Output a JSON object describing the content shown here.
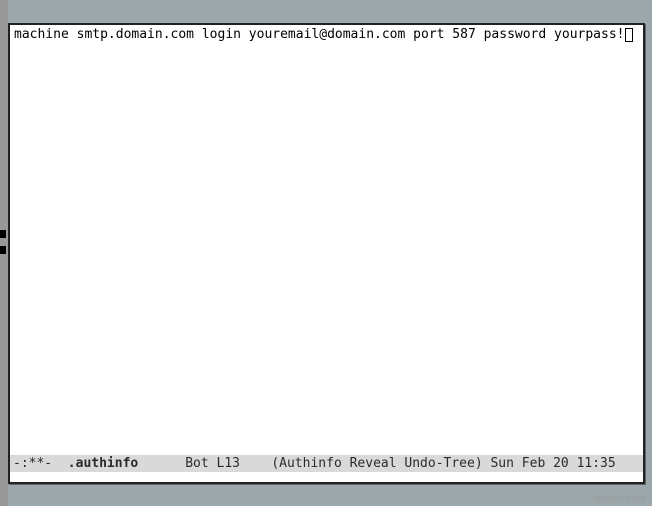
{
  "buffer": {
    "line1": "machine smtp.domain.com login youremail@domain.com port 587 password yourpass!"
  },
  "modeline": {
    "status": "-:**-",
    "buffer_name": ".authinfo",
    "gap1": "      ",
    "position": "Bot L13",
    "gap2": "    ",
    "modes": "(Authinfo Reveal Undo-Tree)",
    "gap3": " ",
    "time": "Sun Feb 20 11:35"
  },
  "watermark": "wsxdn.com"
}
